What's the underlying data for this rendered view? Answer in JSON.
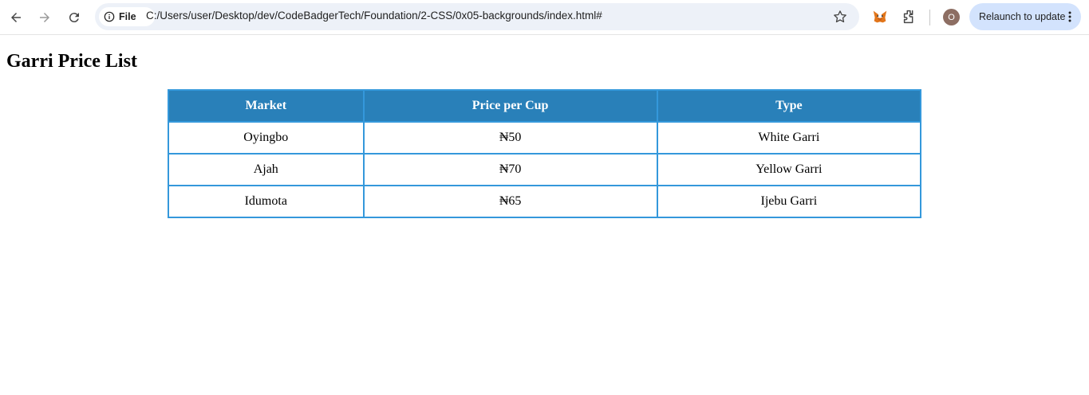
{
  "browser": {
    "site_info_label": "File",
    "url": "C:/Users/user/Desktop/dev/CodeBadgerTech/Foundation/2-CSS/0x05-backgrounds/index.html#",
    "profile_initial": "O",
    "relaunch_label": "Relaunch to update",
    "icons": [
      "back-icon",
      "forward-icon",
      "reload-icon",
      "info-icon",
      "star-icon",
      "metamask-icon",
      "extensions-icon",
      "menu-icon"
    ]
  },
  "page": {
    "title": "Garri Price List",
    "table": {
      "headers": [
        "Market",
        "Price per Cup",
        "Type"
      ],
      "rows": [
        [
          "Oyingbo",
          "₦50",
          "White Garri"
        ],
        [
          "Ajah",
          "₦70",
          "Yellow Garri"
        ],
        [
          "Idumota",
          "₦65",
          "Ijebu Garri"
        ]
      ]
    }
  },
  "colors": {
    "header_bg": "#2980b9",
    "border": "#3498db",
    "relaunch_bg": "#d3e3fd"
  }
}
